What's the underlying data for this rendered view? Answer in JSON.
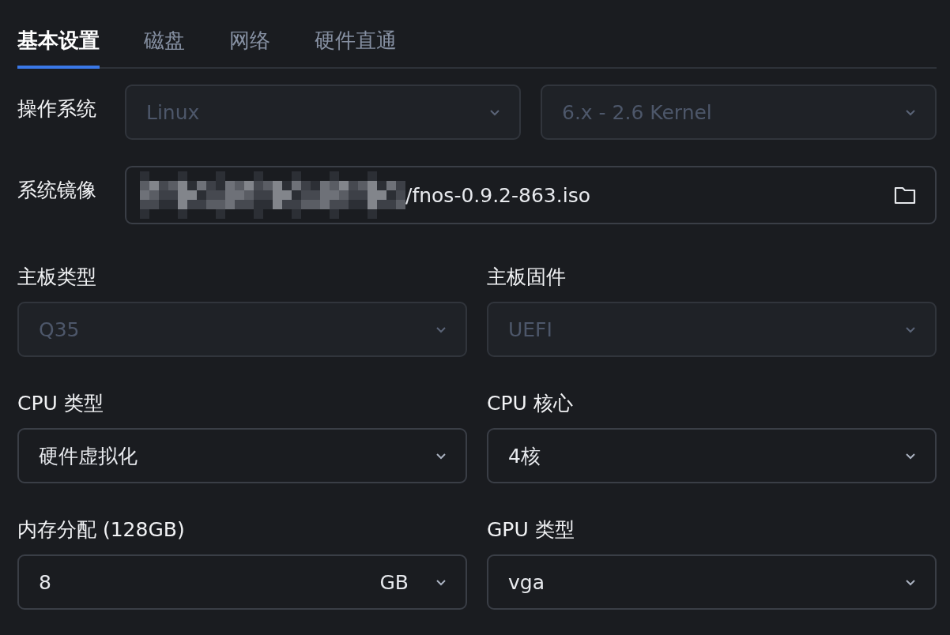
{
  "tabs": [
    {
      "label": "基本设置",
      "selected": true
    },
    {
      "label": "磁盘",
      "selected": false
    },
    {
      "label": "网络",
      "selected": false
    },
    {
      "label": "硬件直通",
      "selected": false
    }
  ],
  "inline_rows": [
    {
      "label": "操作系统",
      "fields": [
        {
          "kind": "select",
          "value": "Linux",
          "disabled": true
        },
        {
          "kind": "select",
          "value": "6.x - 2.6 Kernel",
          "disabled": true
        }
      ]
    },
    {
      "label": "系统镜像",
      "fields": [
        {
          "kind": "file",
          "value": "/fnos-0.9.2-863.iso",
          "redacted": true,
          "disabled": false
        }
      ]
    }
  ],
  "grid_fields": [
    {
      "label": "主板类型",
      "kind": "select",
      "value": "Q35",
      "disabled": true
    },
    {
      "label": "主板固件",
      "kind": "select",
      "value": "UEFI",
      "disabled": true
    },
    {
      "label": "CPU 类型",
      "kind": "select",
      "value": "硬件虚拟化",
      "disabled": false
    },
    {
      "label": "CPU 核心",
      "kind": "select",
      "value": "4核",
      "disabled": false
    },
    {
      "label": "内存分配 (128GB)",
      "kind": "unit",
      "value": "8",
      "unit": "GB",
      "disabled": false
    },
    {
      "label": "GPU 类型",
      "kind": "select",
      "value": "vga",
      "disabled": false
    }
  ]
}
